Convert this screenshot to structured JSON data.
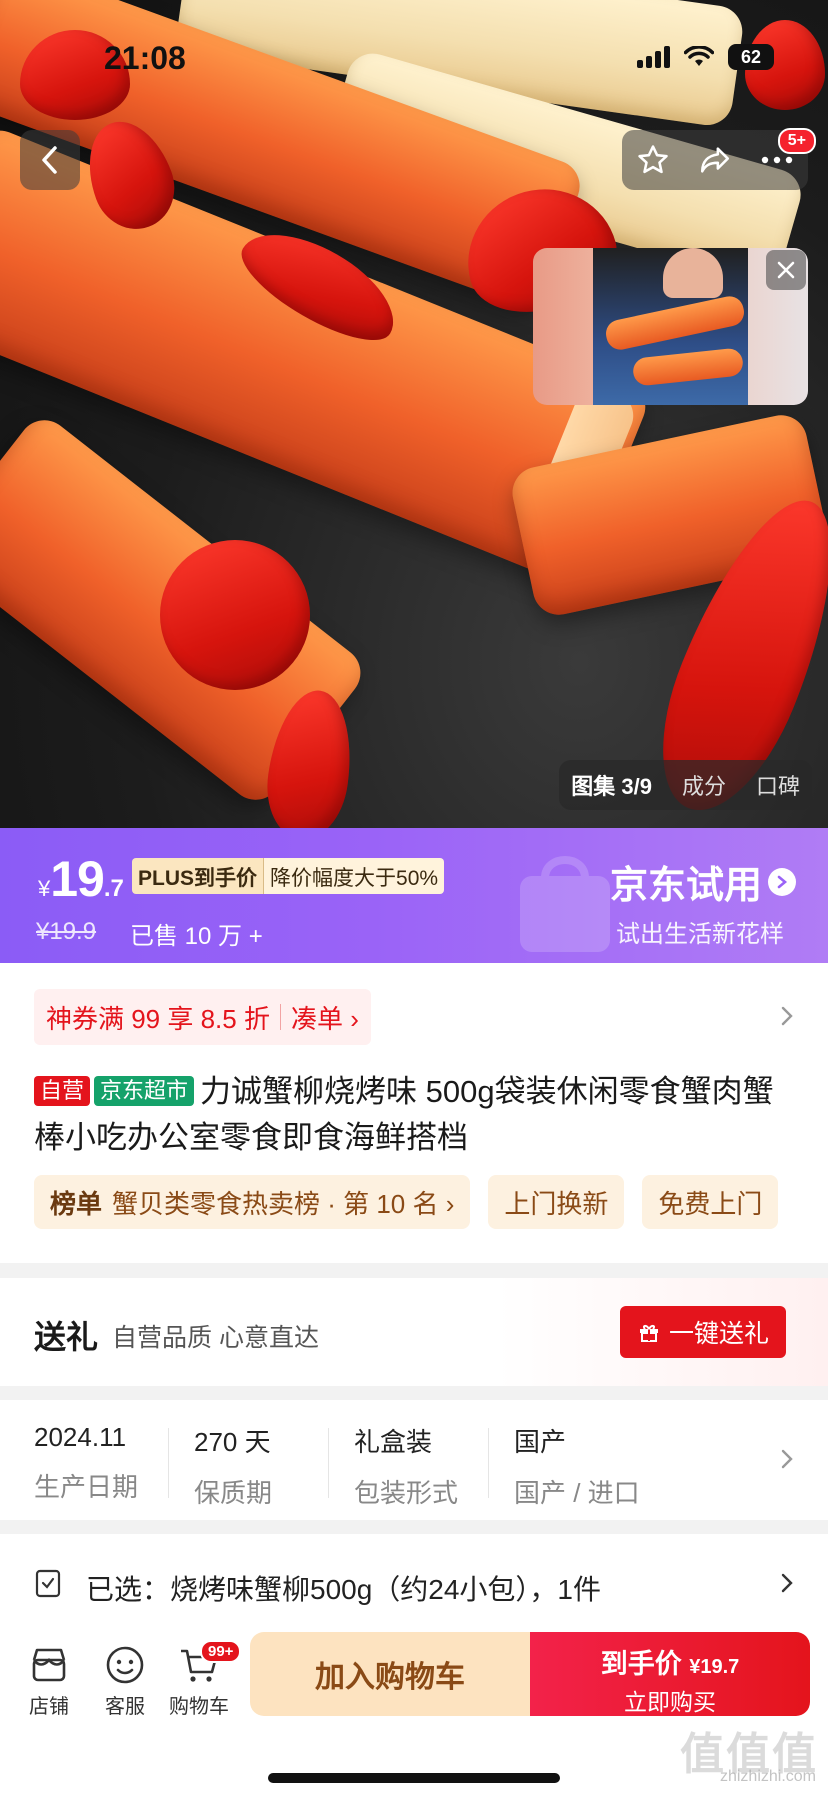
{
  "status_bar": {
    "time": "21:08",
    "battery": "62"
  },
  "top_actions": {
    "badge": "5+"
  },
  "gallery": {
    "tabs": [
      "图集 3/9",
      "成分",
      "口碑"
    ]
  },
  "price": {
    "currency": "¥",
    "integer": "19",
    "decimal": ".7",
    "plus_label": "PLUS到手价",
    "drop_label": "降价幅度大于50%",
    "original": "¥19.9",
    "sold": "已售 10 万 +"
  },
  "trial": {
    "title": "京东试用",
    "subtitle": "试出生活新花样"
  },
  "coupon": {
    "text": "神券满 99 享 8.5 折",
    "action": "凑单 ›"
  },
  "product": {
    "tag_self": "自营",
    "tag_super": "京东超市",
    "title": "力诚蟹柳烧烤味 500g袋装休闲零食蟹肉蟹棒小吃办公室零食即食海鲜搭档"
  },
  "chips": {
    "rank_label": "榜单",
    "rank_text": "蟹贝类零食热卖榜 · 第 10 名 ›",
    "service1": "上门换新",
    "service2": "免费上门"
  },
  "gift": {
    "label": "送礼",
    "subtitle": "自营品质 心意直达",
    "button": "一键送礼"
  },
  "specs": [
    {
      "value": "2024.11",
      "label": "生产日期"
    },
    {
      "value": "270 天",
      "label": "保质期"
    },
    {
      "value": "礼盒装",
      "label": "包装形式"
    },
    {
      "value": "国产",
      "label": "国产 / 进口"
    }
  ],
  "selected": {
    "text": "已选：烧烤味蟹柳500g（约24小包），1件"
  },
  "bottom_bar": {
    "store": "店铺",
    "service": "客服",
    "cart": "购物车",
    "cart_badge": "99+",
    "add_to_cart": "加入购物车",
    "buy_line1": "到手价",
    "buy_price": "¥19.7",
    "buy_line2": "立即购买"
  },
  "watermark": {
    "main": "值值值",
    "sub": "zhizhizhi.com"
  },
  "colors": {
    "jd_red": "#e4141c",
    "banner_purple": "#8b5cf6",
    "super_green": "#15a26a"
  }
}
